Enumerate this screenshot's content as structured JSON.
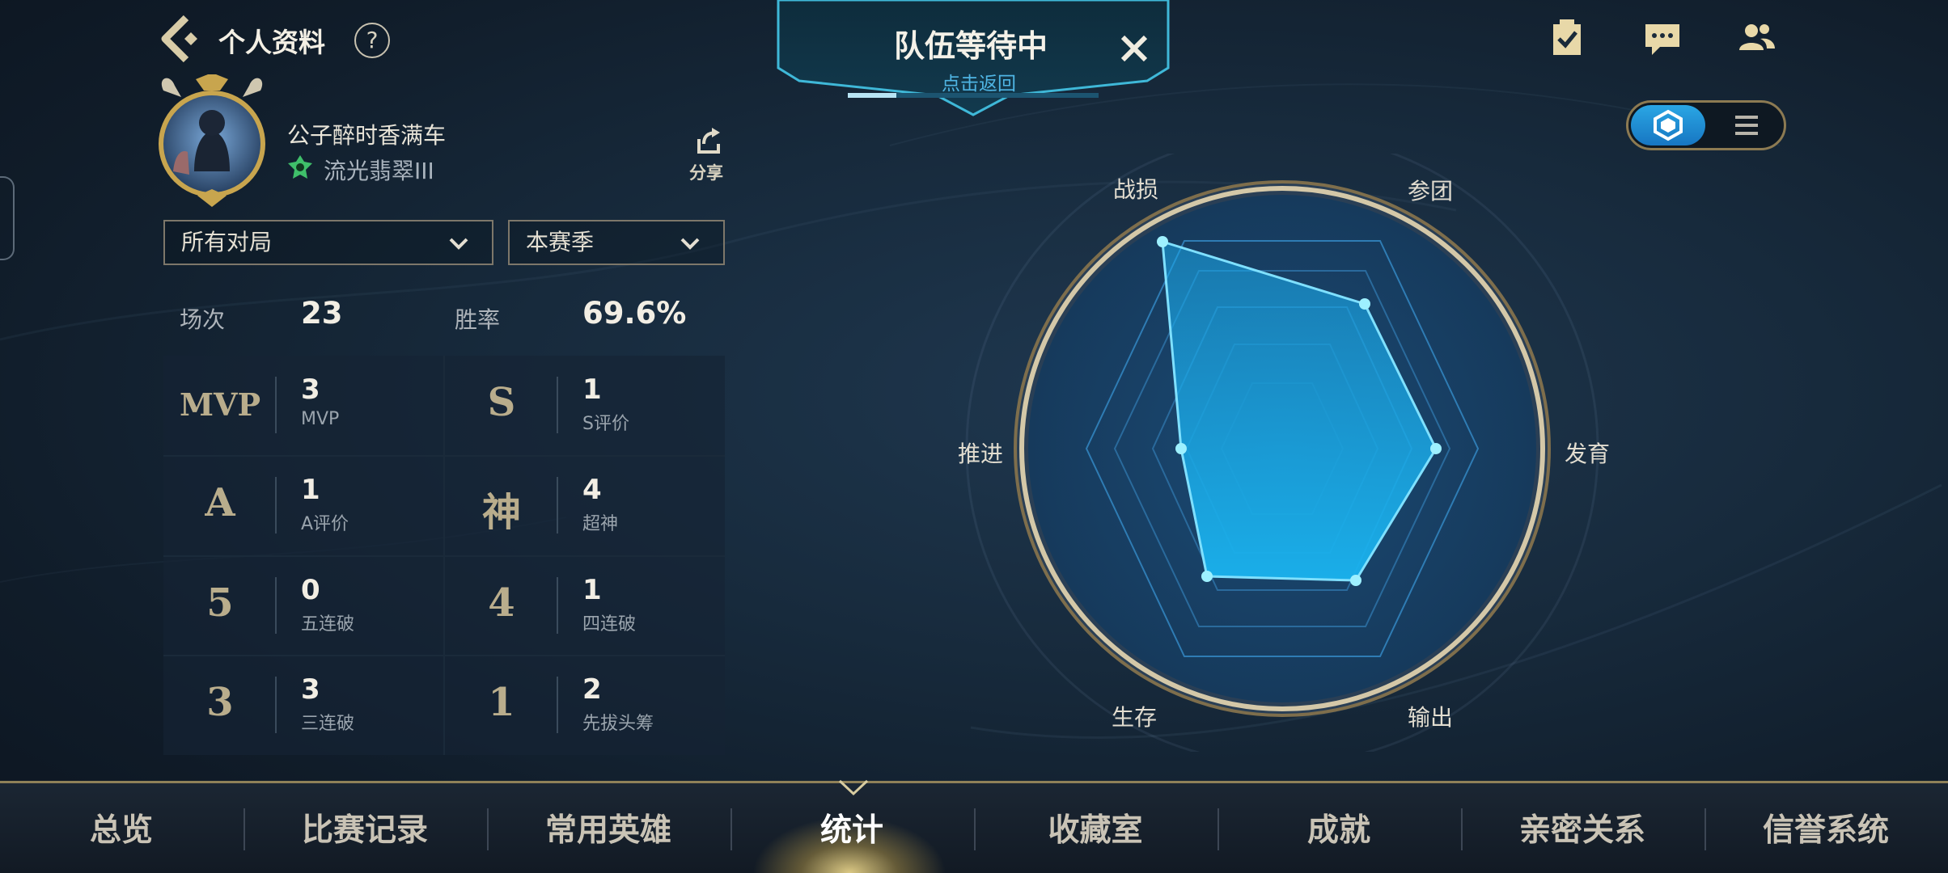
{
  "header": {
    "title": "个人资料",
    "help_label": "?"
  },
  "profile": {
    "username": "公子醉时香满车",
    "rank": "流光翡翠III",
    "share_label": "分享"
  },
  "filters": {
    "mode": "所有对局",
    "season": "本赛季"
  },
  "summary": {
    "matches_label": "场次",
    "matches_value": "23",
    "winrate_label": "胜率",
    "winrate_value": "69.6%"
  },
  "stats": [
    {
      "icon": "MVP",
      "value": "3",
      "label": "MVP"
    },
    {
      "icon": "S",
      "value": "1",
      "label": "S评价"
    },
    {
      "icon": "A",
      "value": "1",
      "label": "A评价"
    },
    {
      "icon": "神",
      "value": "4",
      "label": "超神"
    },
    {
      "icon": "5",
      "value": "0",
      "label": "五连破"
    },
    {
      "icon": "4",
      "value": "1",
      "label": "四连破"
    },
    {
      "icon": "3",
      "value": "3",
      "label": "三连破"
    },
    {
      "icon": "1",
      "value": "2",
      "label": "先拔头筹"
    }
  ],
  "banner": {
    "title": "队伍等待中",
    "subtitle": "点击返回"
  },
  "radar": {
    "labels": {
      "kda": "战损",
      "teamfight": "参团",
      "farm": "发育",
      "damage": "输出",
      "survival": "生存",
      "push": "推进"
    }
  },
  "nav": {
    "tabs": [
      "总览",
      "比赛记录",
      "常用英雄",
      "统计",
      "收藏室",
      "成就",
      "亲密关系",
      "信誉系统"
    ],
    "active_index": 3
  },
  "colors": {
    "accent_blue": "#2aa6e4",
    "gold": "#b9ad8c",
    "highlight": "#4fb5e4"
  }
}
